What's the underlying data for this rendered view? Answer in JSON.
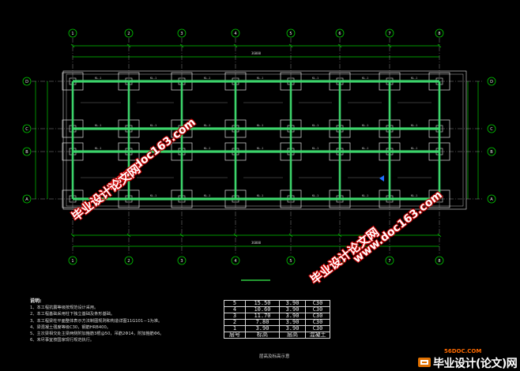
{
  "drawing": {
    "title_bar_label": "",
    "axis_top": [
      "1",
      "2",
      "3",
      "4",
      "5",
      "6",
      "7",
      "8",
      "9"
    ],
    "axis_left": [
      "D",
      "C",
      "B",
      "A"
    ],
    "axis_right": [
      "D",
      "C",
      "B",
      "A"
    ],
    "beam_label": "KL-1",
    "dim_total": "36000",
    "accent_green": "#3cd46b",
    "line_green": "#00c800"
  },
  "notes": {
    "title": "说明:",
    "lines": [
      "1、本工程抗震等级按规范设计采用。",
      "2、本工程基础采用柱下独立基础及条形基础。",
      "3、本工程梁柱平面整体表示方法制图规则和构造详图11G101－1为准。",
      "4、梁混凝土强度等级C30，钢筋HRB400。",
      "5、主次梁相交处主梁两侧附加箍筋3根@50，吊筋2Φ14，附加箍筋Φ6。",
      "6、未尽事宜按国家现行规范执行。"
    ]
  },
  "floor_table": {
    "caption": "层高及标高示意",
    "rows": [
      [
        "5",
        "15.50",
        "3.90",
        "C30"
      ],
      [
        "4",
        "10.60",
        "3.90",
        "C30"
      ],
      [
        "3",
        "11.70",
        "3.90",
        "C30"
      ],
      [
        "2",
        "7.80",
        "3.90",
        "C30"
      ],
      [
        "1",
        "3.90",
        "3.90",
        "C30"
      ],
      [
        "层号",
        "标高",
        "层高",
        "混凝土"
      ]
    ]
  },
  "watermarks": {
    "cn": "毕业设计论文网",
    "url": "www.doc163.com"
  },
  "brand": {
    "url": "56DOC.COM",
    "name": "毕业设计(论文)网"
  }
}
